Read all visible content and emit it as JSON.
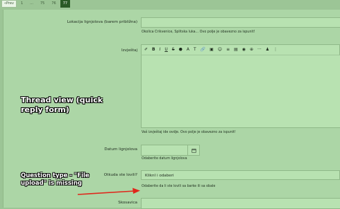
{
  "pager": {
    "prev": "«Prev",
    "pages": [
      "1",
      "...",
      "75",
      "76",
      "77"
    ]
  },
  "form": {
    "location": {
      "label": "Lokacija lignjolova (barem približna)",
      "hint": "Okolica Crikvenice, Splitska luka... Ovo polje je obavezno za ispunit!"
    },
    "report": {
      "label": "Izvještaj",
      "hint": "Vaš izvještaj ide ovdje. Ovo polje je obavezno za ispunit!",
      "toolbar": [
        "✐",
        "B",
        "I",
        "U",
        "S",
        "⬣",
        "A",
        "T",
        "🔗",
        "▣",
        "☺",
        "≡",
        "▤",
        "◉",
        "⊕",
        "···",
        "♟",
        "⋮"
      ]
    },
    "date": {
      "label": "Datum lignjolova",
      "hint": "Odaberite datum lignjolova"
    },
    "where": {
      "label": "Otkuda ste lovili?",
      "select_value": "KliknI i odaberi",
      "hint": "Odaberite da li ste lovili sa barke ili sa obale"
    },
    "tackle": {
      "label": "Skosavica"
    }
  },
  "annotations": {
    "thread_view": "Thread view (quick reply form)",
    "question_type": "Question type - \"File upload\" is missing"
  },
  "colors": {
    "background": "#9cc596",
    "panel": "#acd6a6",
    "input": "#b8e2b1",
    "arrow": "#e0261b"
  }
}
